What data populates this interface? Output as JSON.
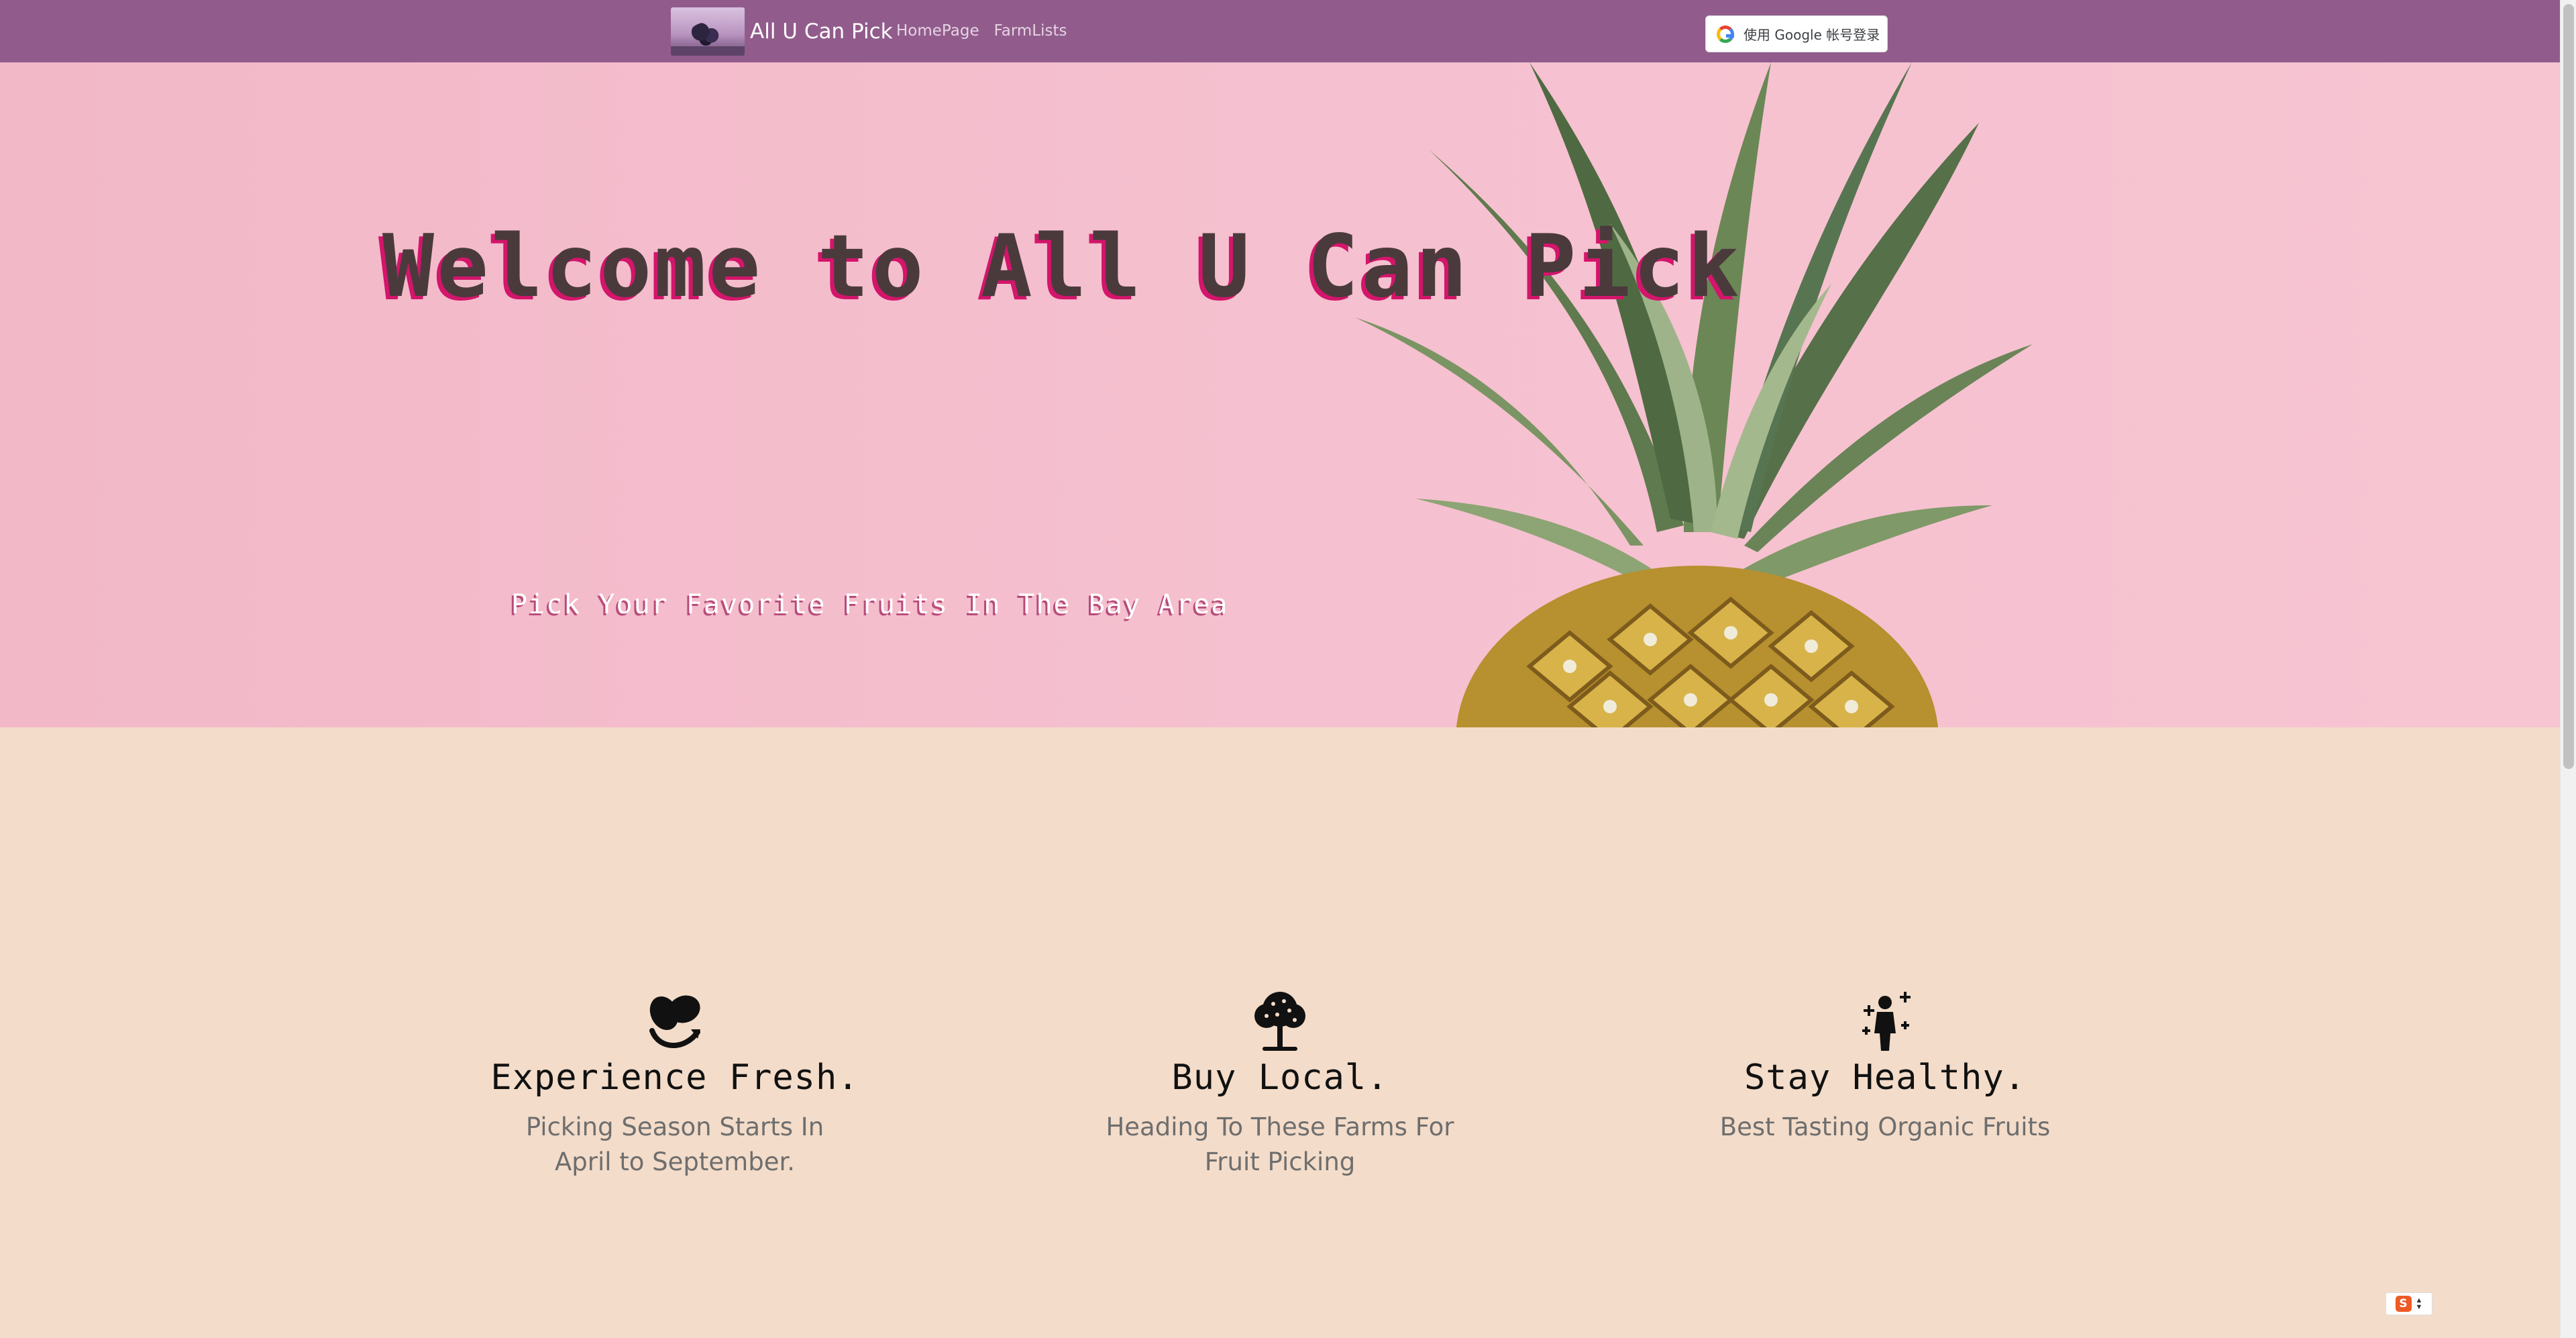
{
  "navbar": {
    "brand": "All U Can Pick",
    "links": [
      "HomePage",
      "FarmLists"
    ],
    "google_signin": "使用 Google 帐号登录"
  },
  "hero": {
    "title": "Welcome to All U Can Pick",
    "subtitle": "Pick Your Favorite Fruits In The Bay Area"
  },
  "features": [
    {
      "icon": "fruit-icon",
      "title": "Experience Fresh.",
      "text": "Picking Season Starts In April to September."
    },
    {
      "icon": "tree-icon",
      "title": "Buy Local.",
      "text": "Heading To These Farms For Fruit Picking"
    },
    {
      "icon": "healthy-person-icon",
      "title": "Stay Healthy.",
      "text": "Best Tasting Organic Fruits"
    }
  ],
  "ime": {
    "logo": "S"
  },
  "colors": {
    "navbar_bg": "#915c8c",
    "hero_bg": "#f5c0cf",
    "features_bg": "#f3dcc9",
    "title_shadow": "#d3156b"
  }
}
